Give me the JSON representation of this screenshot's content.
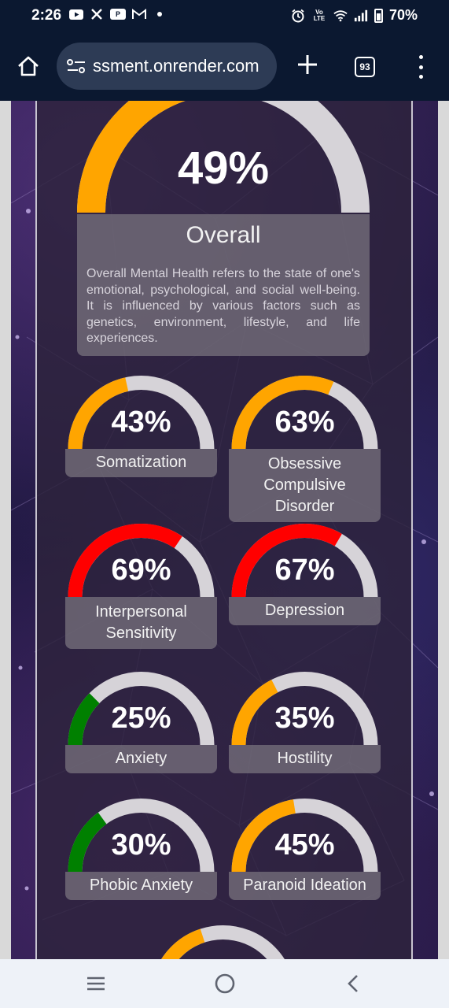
{
  "status_bar": {
    "time": "2:26",
    "battery": "70%",
    "icons_left": [
      "youtube-icon",
      "x-icon",
      "paytm-icon",
      "gmail-icon",
      "dot-icon"
    ],
    "icons_right": [
      "alarm-icon",
      "volte-icon",
      "wifi-icon",
      "signal-icon",
      "battery-icon"
    ],
    "volte_text": "Vo LTE"
  },
  "browser": {
    "url": "ssment.onrender.com",
    "tab_count": "93"
  },
  "overall": {
    "value": 49,
    "value_text": "49%",
    "title": "Overall",
    "description": "Overall Mental Health refers to the state of one's emotional, psychological, and social well-being. It is influenced by various factors such as genetics, environment, lifestyle, and life experiences.",
    "color": "#ffa500"
  },
  "gauges": [
    {
      "value": 43,
      "value_text": "43%",
      "label": "Somatization",
      "color": "#ffa500"
    },
    {
      "value": 63,
      "value_text": "63%",
      "label": "Obsessive Compulsive Disorder",
      "color": "#ffa500"
    },
    {
      "value": 69,
      "value_text": "69%",
      "label": "Interpersonal Sensitivity",
      "color": "#ff0000"
    },
    {
      "value": 67,
      "value_text": "67%",
      "label": "Depression",
      "color": "#ff0000"
    },
    {
      "value": 25,
      "value_text": "25%",
      "label": "Anxiety",
      "color": "#008000"
    },
    {
      "value": 35,
      "value_text": "35%",
      "label": "Hostility",
      "color": "#ffa500"
    },
    {
      "value": 30,
      "value_text": "30%",
      "label": "Phobic Anxiety",
      "color": "#008000"
    },
    {
      "value": 45,
      "value_text": "45%",
      "label": "Paranoid Ideation",
      "color": "#ffa500"
    },
    {
      "value": 40,
      "value_text": "",
      "label": "",
      "color": "#ffa500"
    }
  ],
  "colors": {
    "track": "#d6d3d8",
    "label_bg": "#78737d"
  },
  "nav": [
    "menu-icon",
    "home-circle-icon",
    "back-icon"
  ]
}
